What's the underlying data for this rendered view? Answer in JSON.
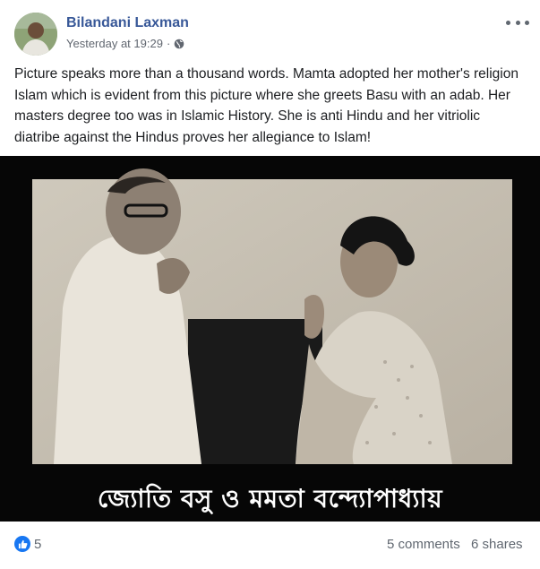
{
  "post": {
    "author": "Bilandani Laxman",
    "time": "Yesterday at 19:29",
    "separator": "·",
    "privacy_icon": "globe-icon",
    "more_icon": "more-options-icon",
    "text": "Picture speaks more than a thousand words. Mamta adopted her mother's religion Islam which is evident from this picture where she greets Basu with an adab. Her masters degree too was in Islamic History. She is anti Hindu and her vitriolic diatribe against the Hindus proves her allegiance to Islam!"
  },
  "image": {
    "caption": "জ্যোতি বসু ও মমতা বন্দ্যোপাধ্যায়"
  },
  "footer": {
    "like_icon": "thumbs-up-icon",
    "reaction_count": "5",
    "comments": "5 comments",
    "shares": "6 shares"
  },
  "colors": {
    "author_link": "#385898",
    "meta_text": "#616770",
    "like_badge": "#1877f2"
  }
}
